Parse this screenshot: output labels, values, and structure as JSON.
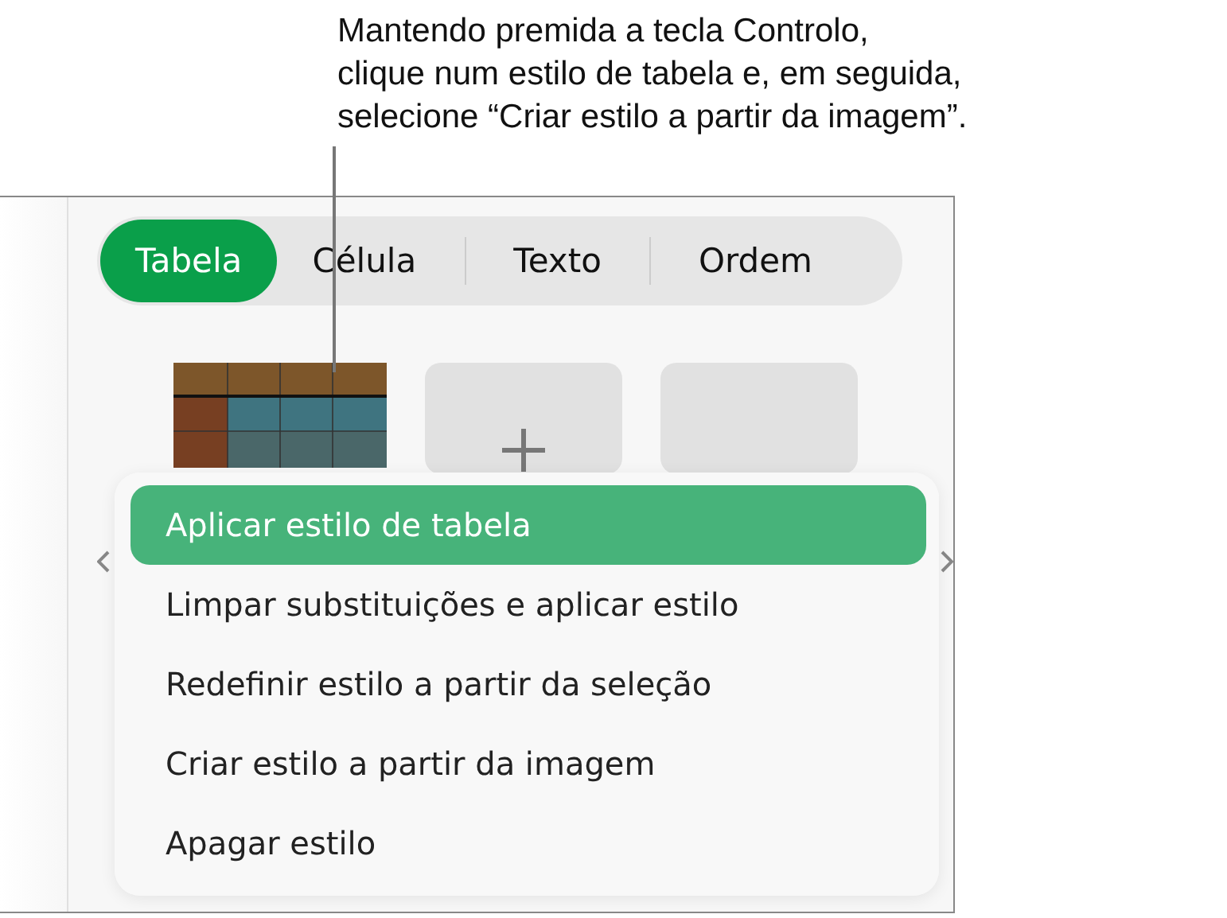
{
  "callout": {
    "lines": [
      "Mantendo premida a tecla Controlo,",
      "clique num estilo de tabela e, em seguida,",
      "selecione “Criar estilo a partir da imagem”."
    ]
  },
  "tabs": [
    {
      "label": "Tabela",
      "selected": true
    },
    {
      "label": "Célula",
      "selected": false
    },
    {
      "label": "Texto",
      "selected": false
    },
    {
      "label": "Ordem",
      "selected": false
    }
  ],
  "styles": [
    {
      "kind": "table"
    },
    {
      "kind": "add"
    },
    {
      "kind": "blank"
    }
  ],
  "menu": [
    {
      "label": "Aplicar estilo de tabela",
      "selected": true
    },
    {
      "label": "Limpar substituições e aplicar estilo",
      "selected": false
    },
    {
      "label": "Redefinir estilo a partir da seleção",
      "selected": false
    },
    {
      "label": "Criar estilo a partir da imagem",
      "selected": false
    },
    {
      "label": "Apagar estilo",
      "selected": false
    }
  ]
}
